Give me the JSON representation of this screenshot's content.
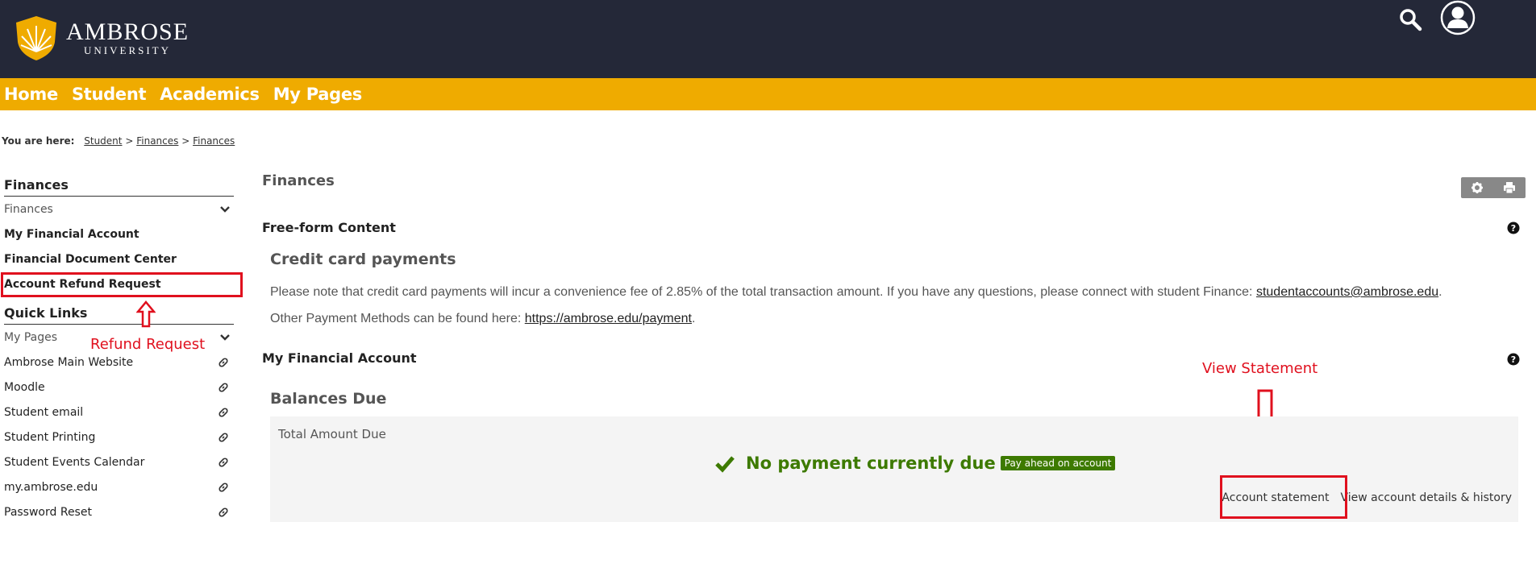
{
  "header": {
    "logo_name": "AMBROSE",
    "logo_sub": "UNIVERSITY",
    "icons": [
      "search-icon",
      "user-icon"
    ]
  },
  "nav": {
    "items": [
      "Home",
      "Student",
      "Academics",
      "My Pages"
    ]
  },
  "breadcrumb": {
    "label": "You are here:",
    "items": [
      "Student",
      "Finances",
      "Finances"
    ],
    "sep": ">"
  },
  "sidebar": {
    "finances_title": "Finances",
    "finances_dropdown": "Finances",
    "finances_links": [
      "My Financial Account",
      "Financial Document Center",
      "Account Refund Request"
    ],
    "quick_links_title": "Quick Links",
    "quick_links_dropdown": "My Pages",
    "quick_links": [
      "Ambrose Main Website",
      "Moodle",
      "Student email",
      "Student Printing",
      "Student Events Calendar",
      "my.ambrose.edu",
      "Password Reset"
    ]
  },
  "annotations": {
    "refund_label": "Refund Request",
    "statement_label": "View Statement",
    "color": "#e0101e"
  },
  "main": {
    "title": "Finances",
    "freeform_title": "Free-form Content",
    "cc_title": "Credit card payments",
    "cc_text": "Please note that credit card payments will incur a convenience fee of 2.85% of the total transaction amount. If you have any questions, please connect with student Finance: ",
    "cc_email": "studentaccounts@ambrose.edu",
    "cc_end": ".",
    "other_text": "Other Payment Methods can be found here: ",
    "other_link": "https://ambrose.edu/payment",
    "other_end": ".",
    "mfa_title": "My Financial Account",
    "balances_title": "Balances Due",
    "total_label": "Total Amount Due",
    "no_payment": "No payment currently due",
    "pay_ahead": "Pay ahead on account",
    "account_statement": "Account statement",
    "view_details": "View account details & history"
  },
  "colors": {
    "header_bg": "#242838",
    "nav_bg": "#efab00",
    "success": "#3d7a00"
  }
}
